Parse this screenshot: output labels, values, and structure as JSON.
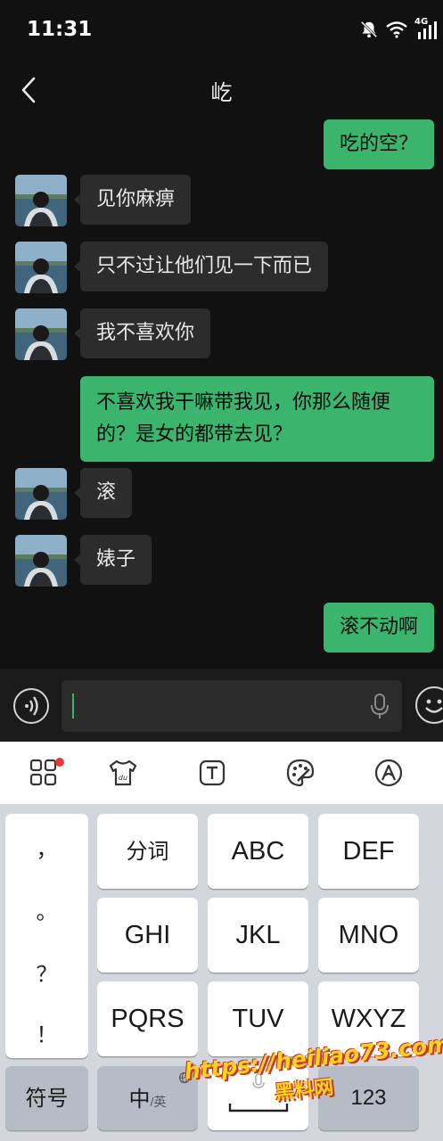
{
  "status": {
    "time": "11:31",
    "icons": [
      "bell-off-icon",
      "wifi-icon",
      "signal-4g-icon"
    ],
    "network_label": "4G"
  },
  "header": {
    "title": "屹"
  },
  "messages": [
    {
      "from": "me",
      "text": "吃的空？"
    },
    {
      "from": "them",
      "text": "见你麻痹"
    },
    {
      "from": "them",
      "text": "只不过让他们见一下而已"
    },
    {
      "from": "them",
      "text": "我不喜欢你"
    },
    {
      "from": "me",
      "line1": "不喜欢我干嘛带我见，你那么随便",
      "line2": "的？是女的都带去见？"
    },
    {
      "from": "them",
      "text": "滚"
    },
    {
      "from": "them",
      "text": "婊子"
    },
    {
      "from": "me",
      "text": "滚不动啊"
    }
  ],
  "input": {
    "value": ""
  },
  "keyboard": {
    "punctuation": [
      "，",
      "。",
      "？",
      "！"
    ],
    "rows": [
      [
        "分词",
        "ABC",
        "DEF"
      ],
      [
        "GHI",
        "JKL",
        "MNO"
      ],
      [
        "PQRS",
        "TUV",
        "WXYZ"
      ]
    ],
    "bottom": {
      "symbols": "符号",
      "lang_main": "中",
      "lang_sub": "/英",
      "numbers": "123"
    }
  },
  "watermark": {
    "url": "https://heiliao73.com",
    "name": "黑料网"
  },
  "colors": {
    "accent": "#3bb46e",
    "background": "#111111",
    "incoming_bubble": "#2c2c2c"
  }
}
